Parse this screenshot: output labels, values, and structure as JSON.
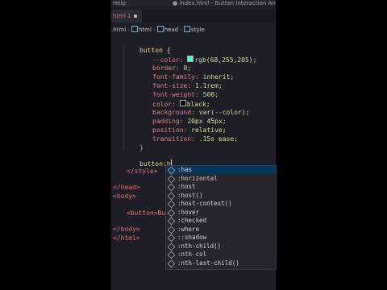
{
  "titlebar": {
    "menu": "Help",
    "title": "● index.html - Button Interaction Animation -"
  },
  "tab": {
    "label": "html 1"
  },
  "breadcrumb": [
    ".html",
    "html",
    "head",
    "style"
  ],
  "code": {
    "l1": "button {",
    "l2p": "--color: ",
    "l2v": "rgb(68,255,205);",
    "l3p": "border: ",
    "l3v": "0;",
    "l4p": "font-family: ",
    "l4v": "inherit;",
    "l5p": "font-size: ",
    "l5v": "1.1rem;",
    "l6p": "font-weight: ",
    "l6v": "500;",
    "l7p": "color: ",
    "l7v": "black;",
    "l8p": "background: ",
    "l8v": "var(--color);",
    "l9p": "padding: ",
    "l9v": "20px 45px;",
    "l10p": "position: ",
    "l10v": "relative;",
    "l11p": "transition: ",
    "l11v": ".15s ease;",
    "l12": "}",
    "l13": "button:h",
    "l14": "</style>",
    "l15": "</head>",
    "l16": "<body>",
    "l17": "<button>Butt",
    "l18": "</body>",
    "l19": "</html>"
  },
  "suggestions": [
    ":has",
    ":horizontal",
    ":host",
    ":host()",
    ":host-context()",
    ":hover",
    ":checked",
    ":where",
    "::shadow",
    ":nth-child()",
    ":nth-col",
    ":nth-last-child()"
  ],
  "colors": {
    "swatch_color": "#44ffcd",
    "swatch_black": "#000000"
  }
}
